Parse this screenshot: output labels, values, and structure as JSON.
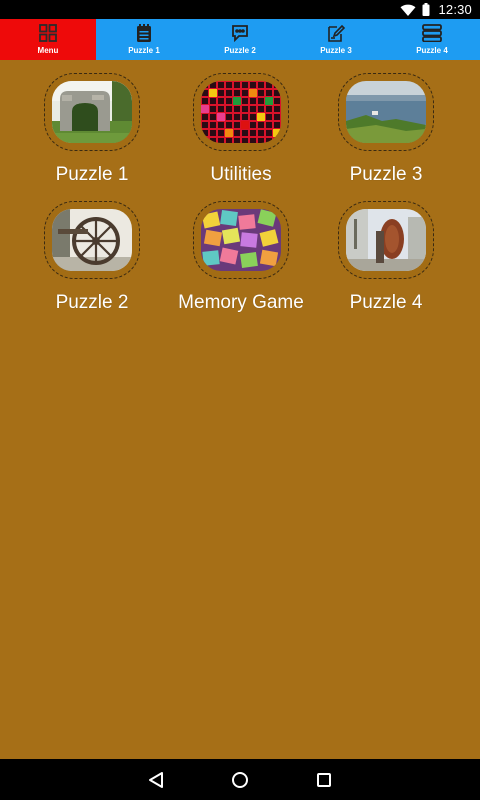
{
  "status_bar": {
    "time": "12:30",
    "icons": [
      "wifi-icon",
      "battery-icon"
    ]
  },
  "tabs": [
    {
      "label": "Menu",
      "icon": "grid-icon",
      "active": true
    },
    {
      "label": "Puzzle 1",
      "icon": "notepad-icon",
      "active": false
    },
    {
      "label": "Puzzle 2",
      "icon": "chat-bubble-icon",
      "active": false
    },
    {
      "label": "Puzzle 3",
      "icon": "edit-icon",
      "active": false
    },
    {
      "label": "Puzzle 4",
      "icon": "storage-icon",
      "active": false
    }
  ],
  "menu_items": [
    {
      "label": "Puzzle 1",
      "image": "stone-arch-ruin"
    },
    {
      "label": "Utilities",
      "image": "colorful-grid-pattern"
    },
    {
      "label": "Puzzle 3",
      "image": "lake-landscape"
    },
    {
      "label": "Puzzle 2",
      "image": "old-wagon-wheel"
    },
    {
      "label": "Memory Game",
      "image": "colorful-memory-tiles"
    },
    {
      "label": "Puzzle 4",
      "image": "rusty-wheel-sculpture"
    }
  ],
  "nav_bar": {
    "buttons": [
      "back-icon",
      "home-icon",
      "recents-icon"
    ]
  },
  "colors": {
    "tab_bar": "#1e9cf2",
    "tab_active": "#ee0a0a",
    "content_background": "#a66f17",
    "text": "#ffffff"
  }
}
